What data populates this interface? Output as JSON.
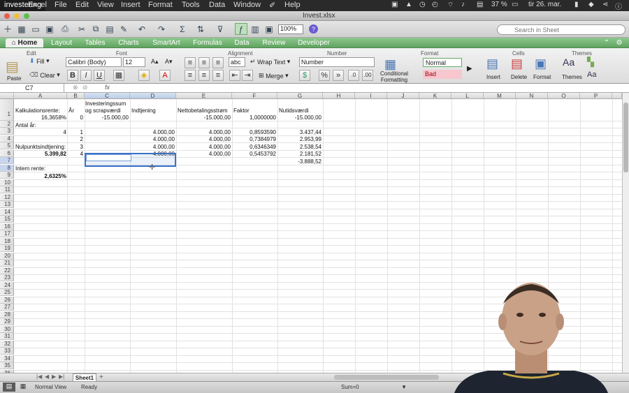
{
  "menubar": {
    "app_name": "investering",
    "items": [
      "Excel",
      "File",
      "Edit",
      "View",
      "Insert",
      "Format",
      "Tools",
      "Data",
      "Window",
      "Help"
    ],
    "battery": "37 %",
    "clock": "tir 26. mar."
  },
  "window": {
    "title": "Invest.xlsx"
  },
  "toolbar": {
    "zoom": "100%",
    "search_placeholder": "Search in Sheet"
  },
  "tabs": [
    "Home",
    "Layout",
    "Tables",
    "Charts",
    "SmartArt",
    "Formulas",
    "Data",
    "Review",
    "Developer"
  ],
  "ribbon": {
    "groups": {
      "edit": "Edit",
      "font": "Font",
      "alignment": "Alignment",
      "number": "Number",
      "format": "Format",
      "cells": "Cells",
      "themes": "Themes"
    },
    "paste": "Paste",
    "fill": "Fill",
    "clear": "Clear",
    "font_name": "Calibri (Body)",
    "font_size": "12",
    "bold": "B",
    "italic": "I",
    "underline": "U",
    "abc": "abc",
    "wrap_text": "Wrap Text",
    "merge": "Merge",
    "number_format": "Number",
    "percent": "%",
    "comma": "»",
    "cond_format": "Conditional Formatting",
    "style_normal": "Normal",
    "style_bad": "Bad",
    "insert": "Insert",
    "delete": "Delete",
    "format": "Format",
    "themes": "Themes"
  },
  "formula_bar": {
    "name_box": "C7",
    "fx": "fx",
    "value": ""
  },
  "columns": [
    "A",
    "B",
    "C",
    "D",
    "E",
    "F",
    "G",
    "H",
    "I",
    "J",
    "K",
    "L",
    "M",
    "N",
    "O",
    "P"
  ],
  "rows": [
    "1",
    "2",
    "3",
    "4",
    "5",
    "6",
    "7",
    "8",
    "9",
    "10",
    "11",
    "12",
    "13",
    "14",
    "15",
    "16",
    "17",
    "18",
    "19",
    "20",
    "21",
    "22",
    "23",
    "24",
    "25",
    "26",
    "27",
    "28",
    "29",
    "30",
    "31",
    "32",
    "33",
    "34",
    "35",
    "36"
  ],
  "cells": {
    "c1_top": "Investeringssum",
    "a1": "Kalkulationsrente:",
    "b1": "År",
    "c1": "og scrapværdi",
    "d1": "Indtjening",
    "e1": "Nettobetalingsstrøm",
    "f1": "Faktor",
    "g1": "Nutidsværdi",
    "a2": "16,3658%",
    "b2": "0",
    "c2": "-15.000,00",
    "e2": "-15.000,00",
    "f2": "1,0000000",
    "g2": "-15.000,00",
    "a3": "Antal år:",
    "b3": "1",
    "d3": "4.000,00",
    "e3": "4.000,00",
    "f3": "0,8593590",
    "g3": "3.437,44",
    "a4": "4",
    "b4": "2",
    "d4": "4.000,00",
    "e4": "4.000,00",
    "f4": "0,7384979",
    "g4": "2.953,99",
    "a5": "Nulpunktsindtjening:",
    "b5": "3",
    "d5": "4.000,00",
    "e5": "4.000,00",
    "f5": "0,6346349",
    "g5": "2.538,54",
    "a6": "5.399,82",
    "b6": "4",
    "d6": "4.000,00",
    "e6": "4.000,00",
    "f6": "0,5453792",
    "g6": "2.181,52",
    "g7": "-3.888,52",
    "a8": "Intern rente:",
    "a9": "2,6325%"
  },
  "sheet_tab": "Sheet1",
  "status": {
    "view": "Normal View",
    "state": "Ready",
    "sum": "Sum=0"
  },
  "colors": {
    "tab_green": "#6fb06f",
    "selection": "#3a72c8",
    "style_bad_bg": "#f7c6ce",
    "style_bad_text": "#9c0006"
  }
}
